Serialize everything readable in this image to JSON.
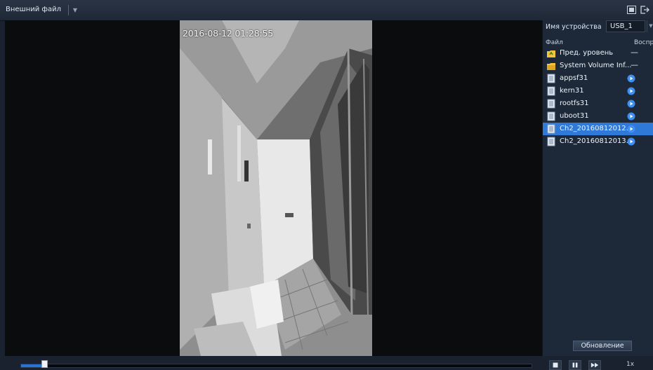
{
  "topbar": {
    "title": "Внешний файл",
    "icons": [
      "dropdown-arrow-icon",
      "fullscreen-icon",
      "exit-icon"
    ]
  },
  "video": {
    "timestamp": "2016-08-12  01:28:55"
  },
  "panel": {
    "device_label": "Имя устройства",
    "device_value": "USB_1",
    "col_file": "Файл",
    "col_play": "Воспрои",
    "files": [
      {
        "name": "Пред. уровень",
        "type": "folder-up",
        "action": "—"
      },
      {
        "name": "System Volume Inf...",
        "type": "folder",
        "action": "—"
      },
      {
        "name": "appsf31",
        "type": "file",
        "action": "play"
      },
      {
        "name": "kern31",
        "type": "file",
        "action": "play"
      },
      {
        "name": "rootfs31",
        "type": "file",
        "action": "play"
      },
      {
        "name": "uboot31",
        "type": "file",
        "action": "play"
      },
      {
        "name": "Ch2_20160812012...",
        "type": "file",
        "action": "play",
        "selected": true
      },
      {
        "name": "Ch2_20160812013...",
        "type": "file",
        "action": "play"
      }
    ],
    "refresh_label": "Обновление"
  },
  "playback": {
    "progress": 0.045,
    "speed": "1x",
    "controls": [
      "stop-icon",
      "pause-icon",
      "fast-forward-icon"
    ]
  },
  "colors": {
    "accent": "#2f79d8",
    "background": "#1a2230",
    "panel": "#1d2838"
  }
}
